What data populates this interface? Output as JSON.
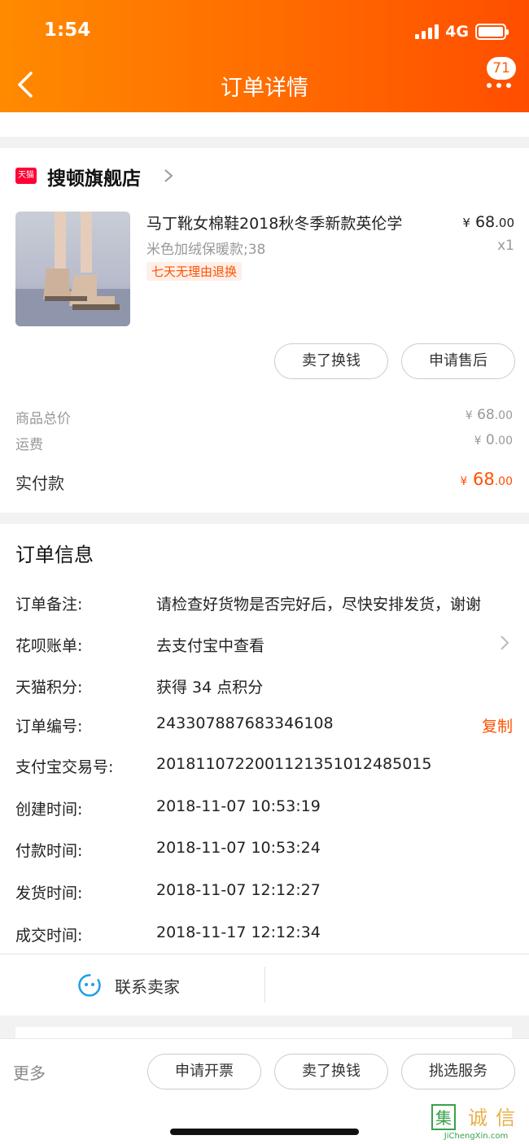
{
  "status_bar": {
    "time": "1:54",
    "network": "4G"
  },
  "header": {
    "title": "订单详情",
    "badge": "71"
  },
  "shop": {
    "logo_text": "天猫",
    "name": "搜顿旗舰店",
    "product": {
      "title": "马丁靴女棉鞋2018秋冬季新款英伦学",
      "spec": "米色加绒保暖款;38",
      "tag": "七天无理由退换",
      "price_symbol": "¥",
      "price_int": "68",
      "price_dec": ".00",
      "qty": "x1"
    },
    "buttons": [
      "卖了换钱",
      "申请售后"
    ],
    "summary": {
      "goods_label": "商品总价",
      "goods_sym": "¥",
      "goods_int": "68",
      "goods_dec": ".00",
      "ship_label": "运费",
      "ship_sym": "¥",
      "ship_int": "0",
      "ship_dec": ".00",
      "paid_label": "实付款",
      "paid_sym": "¥",
      "paid_int": "68",
      "paid_dec": ".00"
    }
  },
  "order_info": {
    "title": "订单信息",
    "rows": [
      {
        "label": "订单备注:",
        "value": "请检查好货物是否完好后，尽快安排发货，谢谢"
      },
      {
        "label": "花呗账单:",
        "value": "去支付宝中查看"
      },
      {
        "label": "天猫积分:",
        "value": "获得 34 点积分"
      },
      {
        "label": "订单编号:",
        "value": "243307887683346108"
      },
      {
        "label": "支付宝交易号:",
        "value": "2018110722001121351012485015"
      },
      {
        "label": "创建时间:",
        "value": "2018-11-07 10:53:19"
      },
      {
        "label": "付款时间:",
        "value": "2018-11-07 10:53:24"
      },
      {
        "label": "发货时间:",
        "value": "2018-11-07 12:12:27"
      },
      {
        "label": "成交时间:",
        "value": "2018-11-17 12:12:34"
      }
    ],
    "copy_label": "复制",
    "contact_label": "联系卖家"
  },
  "bottom_bar": {
    "more_label": "更多",
    "buttons": [
      "申请开票",
      "卖了换钱",
      "挑选服务"
    ]
  },
  "watermark": {
    "text": "集诚信",
    "url": "JiChengXin.com"
  },
  "colors": {
    "accent": "#ff5000",
    "header_from": "#ff8a00",
    "header_to": "#ff4e00"
  }
}
